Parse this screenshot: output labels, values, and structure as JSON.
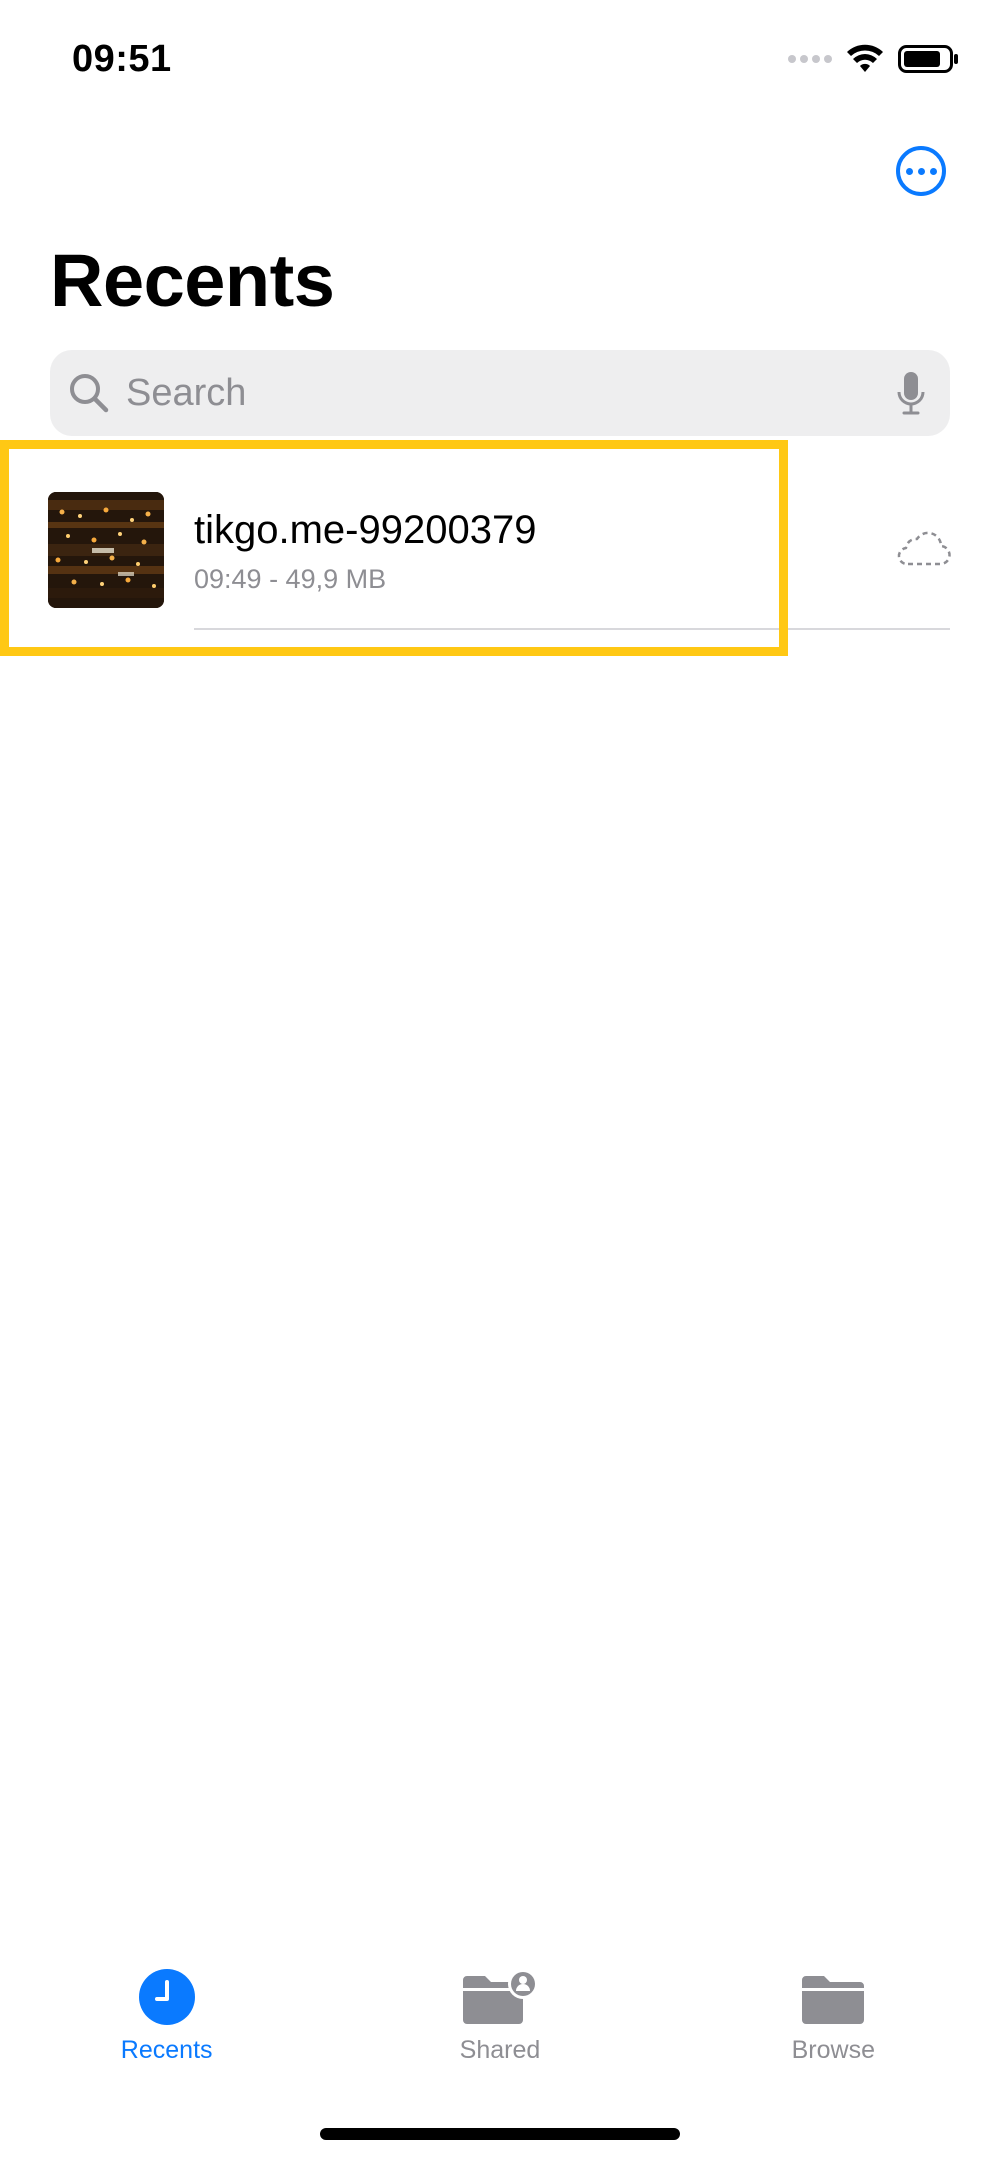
{
  "status_bar": {
    "time": "09:51"
  },
  "header": {
    "title": "Recents",
    "more_button_icon": "ellipsis-circle-icon"
  },
  "search": {
    "placeholder": "Search",
    "value": ""
  },
  "files": [
    {
      "name": "tikgo.me-99200379",
      "meta": "09:49 - 49,9 MB",
      "status_icon": "cloud-download-icon"
    }
  ],
  "tabs": [
    {
      "label": "Recents",
      "icon": "clock-icon",
      "active": true
    },
    {
      "label": "Shared",
      "icon": "shared-folder-icon",
      "active": false
    },
    {
      "label": "Browse",
      "icon": "folder-icon",
      "active": false
    }
  ],
  "colors": {
    "accent": "#0a7aff",
    "highlight": "#ffc814",
    "secondary_text": "#8e8e93",
    "search_bg": "#eeeeef"
  }
}
